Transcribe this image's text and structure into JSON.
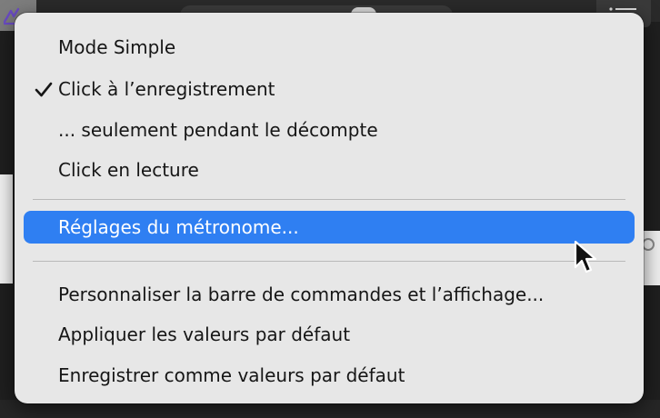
{
  "menu": {
    "items": [
      {
        "label": "Mode Simple",
        "checked": false,
        "highlighted": false
      },
      {
        "label": "Click à l’enregistrement",
        "checked": true,
        "highlighted": false
      },
      {
        "label": "... seulement pendant le décompte",
        "checked": false,
        "highlighted": false
      },
      {
        "label": "Click en lecture",
        "checked": false,
        "highlighted": false
      },
      {
        "label": "Réglages du métronome...",
        "checked": false,
        "highlighted": true
      },
      {
        "label": "Personnaliser la barre de commandes et l’affichage...",
        "checked": false,
        "highlighted": false
      },
      {
        "label": "Appliquer les valeurs par défaut",
        "checked": false,
        "highlighted": false
      },
      {
        "label": "Enregistrer comme valeurs par défaut",
        "checked": false,
        "highlighted": false
      }
    ]
  },
  "colors": {
    "menu_background": "#e7e7e7",
    "highlight": "#2f7ff2",
    "separator": "#b9b9b9",
    "text": "#161616",
    "highlight_text": "#ffffff"
  },
  "icons": {
    "checkmark": "checkmark-icon",
    "cursor": "mouse-pointer-icon",
    "toolbar_left": "pencil-curve-icon",
    "toolbar_right": "list-icon"
  }
}
